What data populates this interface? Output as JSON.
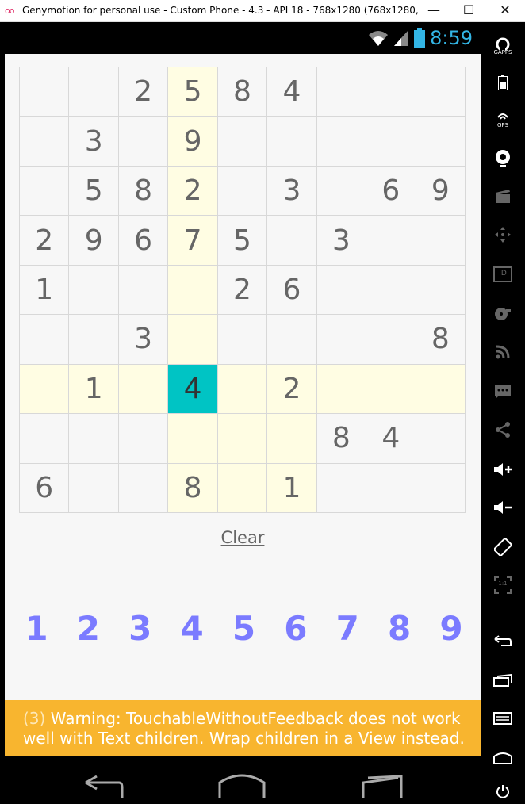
{
  "window": {
    "title": "Genymotion for personal use - Custom Phone - 4.3 - API 18 - 768x1280 (768x1280, 320dpi) - ...",
    "logo": "oo",
    "minimize": "—",
    "maximize": "☐",
    "close": "✕"
  },
  "statusbar": {
    "time": "8:59"
  },
  "sudoku": {
    "cells": [
      [
        "",
        "",
        "2",
        "5",
        "8",
        "4",
        "",
        "",
        ""
      ],
      [
        "",
        "3",
        "",
        "9",
        "",
        "",
        "",
        "",
        ""
      ],
      [
        "",
        "5",
        "8",
        "2",
        "",
        "3",
        "",
        "6",
        "9"
      ],
      [
        "2",
        "9",
        "6",
        "7",
        "5",
        "",
        "3",
        "",
        ""
      ],
      [
        "1",
        "",
        "",
        "",
        "2",
        "6",
        "",
        "",
        ""
      ],
      [
        "",
        "",
        "3",
        "",
        "",
        "",
        "",
        "",
        "8"
      ],
      [
        "",
        "1",
        "",
        "4",
        "",
        "2",
        "",
        "",
        ""
      ],
      [
        "",
        "",
        "",
        "",
        "",
        "",
        "8",
        "4",
        ""
      ],
      [
        "6",
        "",
        "",
        "8",
        "",
        "1",
        "",
        "",
        ""
      ]
    ],
    "selected": {
      "row": 7,
      "col": 4
    },
    "selected_color": "#00c4c4",
    "highlight_color": "#fffde3"
  },
  "clear_label": "Clear",
  "numpad": [
    "1",
    "2",
    "3",
    "4",
    "5",
    "6",
    "7",
    "8",
    "9"
  ],
  "numpad_color": "#7b7bff",
  "warning": {
    "count": "(3)",
    "line1": "Warning: TouchableWithoutFeedback does not work",
    "line2": "well with Text children. Wrap children in a View instead..."
  },
  "sidebar": {
    "gapps_label": "GAPPS",
    "gps_label": "GPS",
    "id_label": "ID",
    "scale_label": "1:1"
  }
}
